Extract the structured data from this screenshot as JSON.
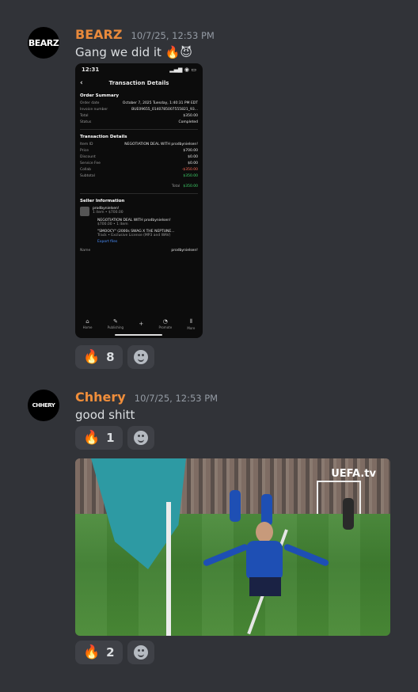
{
  "messages": [
    {
      "username": "BEARZ",
      "timestamp": "10/7/25, 12:53 PM",
      "avatar_text": "BEARZ",
      "text": "Gang we did it 🔥😈",
      "reaction": {
        "emoji": "🔥",
        "count": "8"
      }
    },
    {
      "username": "Chhery",
      "timestamp": "10/7/25, 12:53 PM",
      "avatar_text": "CHHERY",
      "text": "good shitt",
      "reaction": {
        "emoji": "🔥",
        "count": "1"
      }
    }
  ],
  "gif": {
    "watermark": "UEFA.tv",
    "reaction": {
      "emoji": "🔥",
      "count": "2"
    }
  },
  "phone": {
    "time": "12:31",
    "title": "Transaction Details",
    "order_summary": {
      "heading": "Order Summary",
      "rows": [
        {
          "k": "Order date",
          "v": "October 7, 2025 Tuesday, 1:40:31 PM EDT"
        },
        {
          "k": "Invoice number",
          "v": "BUE09655_0140785007555821_93..."
        },
        {
          "k": "Total",
          "v": "$350.00"
        },
        {
          "k": "Status",
          "v": "Completed"
        }
      ]
    },
    "transaction_details": {
      "heading": "Transaction Details",
      "rows": [
        {
          "k": "Item ID",
          "v": "NEGOTIATION DEAL WITH prodbynielsen!"
        },
        {
          "k": "Price",
          "v": "$700.00"
        },
        {
          "k": "Discount",
          "v": "$0.00"
        },
        {
          "k": "Service Fee",
          "v": "$0.00"
        },
        {
          "k": "Collab",
          "v": "-$350.00"
        },
        {
          "k": "Subtotal",
          "v": "$350.00"
        }
      ],
      "total_label": "Total",
      "total_value": "$350.00"
    },
    "seller": {
      "heading": "Seller Information",
      "name": "prodbynielsen!",
      "meta": "1 item • $700.00",
      "deal": "NEGOTIATION DEAL WITH prodbynielsen!",
      "deal_meta": "$700.00 • 1 item",
      "track": "\"SMOOCY\" (2000s SWAG X THE NEPTUNE...",
      "track_meta": "Track • Exclusive License (MP3 and WAV)",
      "export": "Export files",
      "name_label": "Name",
      "name_value": "prodbynielsen!"
    },
    "tabs": [
      "Home",
      "Publishing",
      "+",
      "Promote",
      "More"
    ]
  }
}
